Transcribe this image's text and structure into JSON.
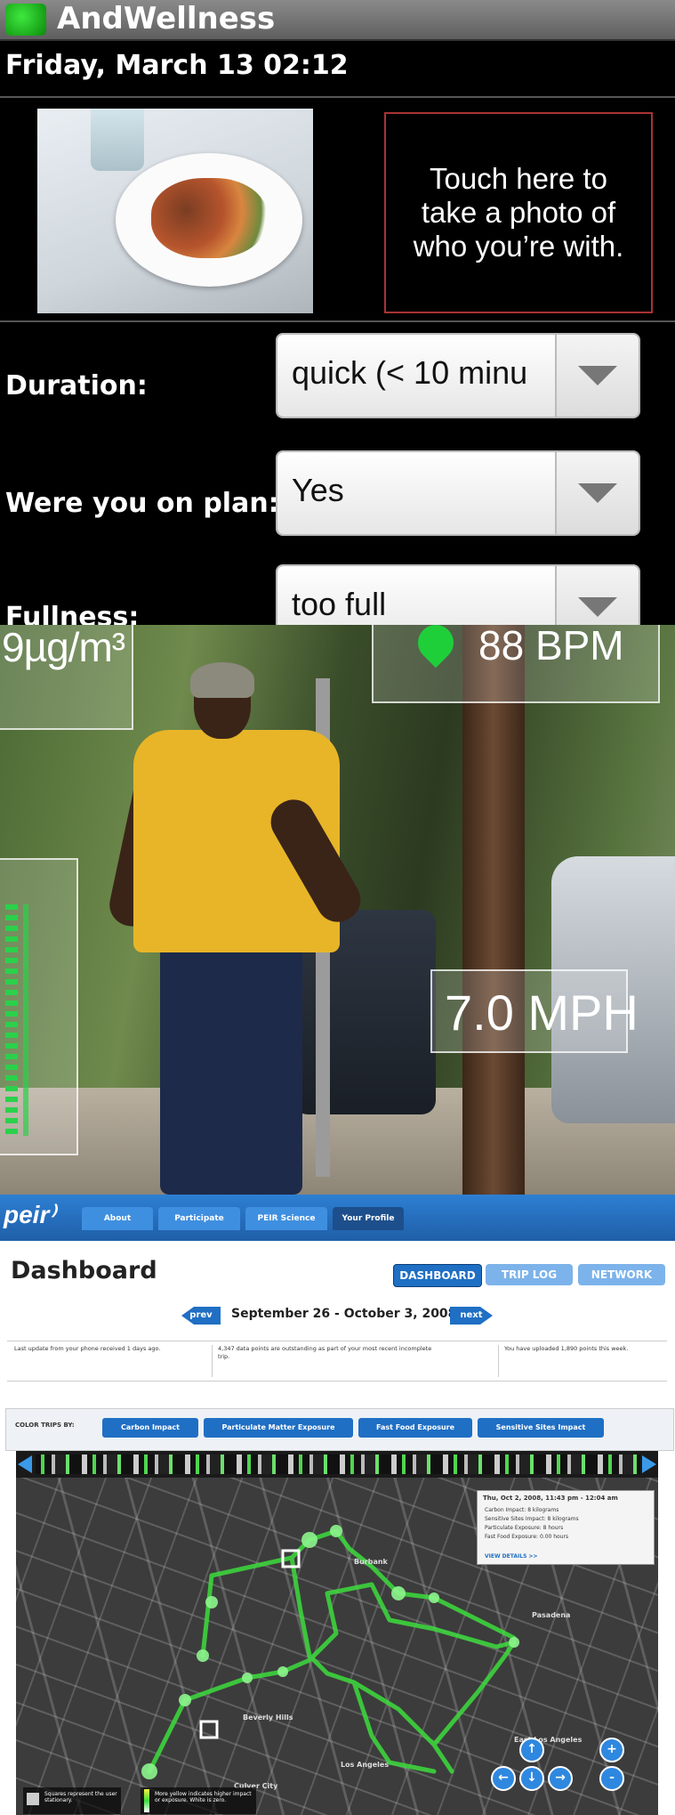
{
  "panel1": {
    "app_title": "AndWellness",
    "datetime": "Friday, March 13 02:12",
    "photo_button_text": "Touch here to\ntake a photo of\nwho you’re with.",
    "fields": [
      {
        "label": "Duration:",
        "value": "quick (< 10 minu"
      },
      {
        "label": "Were you on plan:",
        "value": "Yes"
      },
      {
        "label": "Fullness:",
        "value": "too full"
      }
    ]
  },
  "panel2": {
    "pm_reading": "9µg/m³",
    "heart_rate": "88 BPM",
    "speed": "7.0 MPH"
  },
  "panel3": {
    "logo": "peir⁾",
    "nav_tabs": [
      "About",
      "Participate",
      "PEIR Science",
      "Your Profile"
    ],
    "page_title": "Dashboard",
    "view_tabs": [
      "DASHBOARD",
      "TRIP LOG",
      "NETWORK"
    ],
    "prev_label": "prev",
    "next_label": "next",
    "date_range": "September 26 - October 3, 2008",
    "info": [
      "Last update from your phone received 1 days ago.",
      "4,347 data points are outstanding as part of your most recent incomplete trip.",
      "You have uploaded 1,890 points this week."
    ],
    "color_trips_label": "COLOR TRIPS BY:",
    "color_trip_buttons": [
      "Carbon Impact",
      "Particulate Matter Exposure",
      "Fast Food Exposure",
      "Sensitive Sites Impact"
    ],
    "popup": {
      "title": "Thu, Oct 2, 2008, 11:43 pm - 12:04 am",
      "lines": [
        "Carbon Impact: 8 kilograms",
        "Sensitive Sites Impact: 8 kilograms",
        "Particulate Exposure: 8 hours",
        "Fast Food Exposure: 0.00 hours"
      ],
      "link": "VIEW DETAILS >>"
    },
    "legend": [
      "Squares represent the user stationary.",
      "More yellow indicates higher impact or exposure. White is zero."
    ],
    "map_labels": [
      "Los Angeles",
      "Burbank",
      "Pasadena",
      "Beverly Hills",
      "Culver City",
      "East Los Angeles"
    ],
    "controls": [
      "+",
      "-",
      "↑",
      "↓",
      "←",
      "→"
    ],
    "route_color": "#3ddc3d"
  }
}
